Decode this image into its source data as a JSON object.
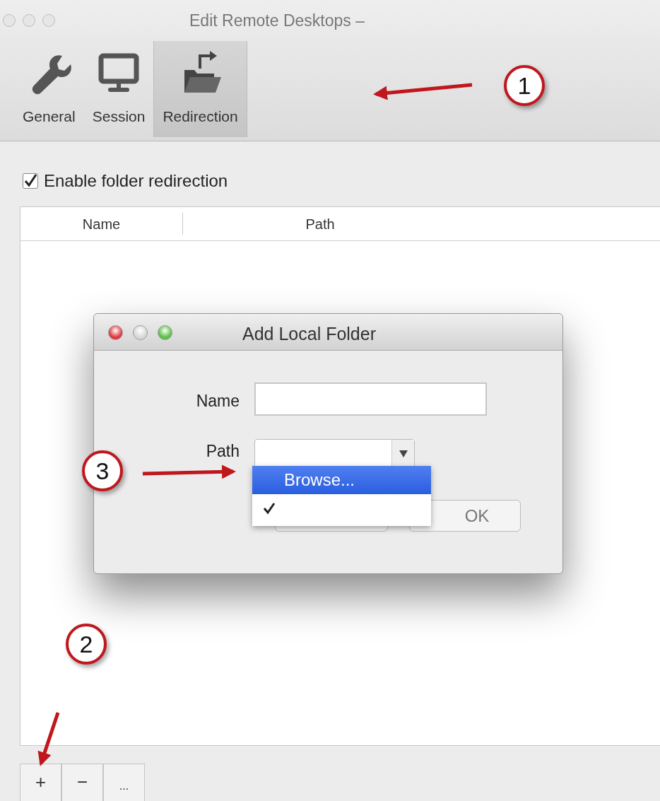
{
  "window": {
    "title": "Edit Remote Desktops –"
  },
  "toolbar": [
    {
      "label": "General",
      "selected": false
    },
    {
      "label": "Session",
      "selected": false
    },
    {
      "label": "Redirection",
      "selected": true
    }
  ],
  "enable_checkbox": {
    "label": "Enable folder redirection",
    "checked": true
  },
  "table": {
    "columns": [
      "Name",
      "Path"
    ]
  },
  "bottom_buttons": [
    "+",
    "−",
    "..."
  ],
  "dialog": {
    "title": "Add Local Folder",
    "name_label": "Name",
    "path_label": "Path",
    "path_menu": [
      {
        "label": "Browse...",
        "selected": true,
        "checked": false
      },
      {
        "selected": false,
        "checked": true
      }
    ],
    "ok_button": "OK"
  },
  "annotations": [
    "1",
    "2",
    "3"
  ]
}
